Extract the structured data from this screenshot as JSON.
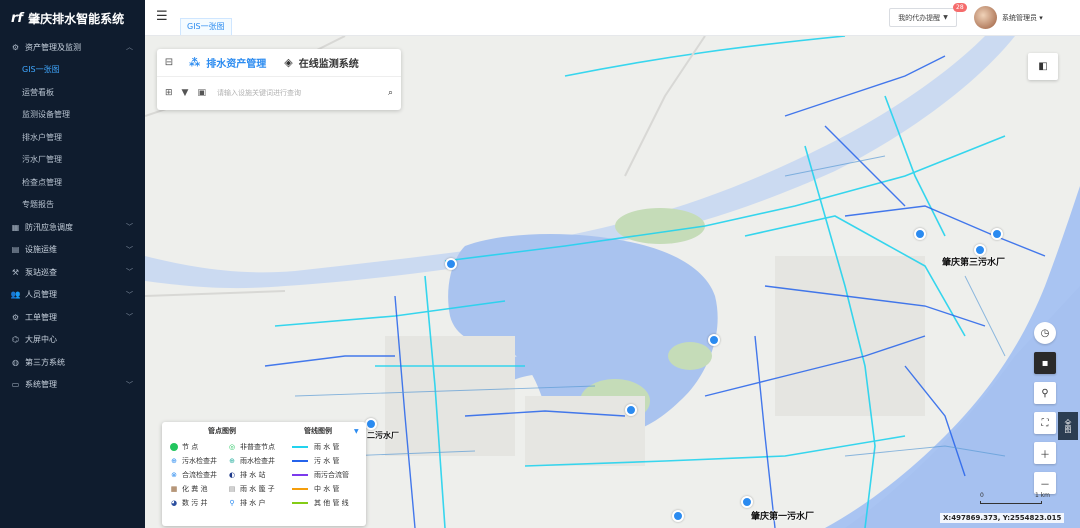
{
  "brand": {
    "logo": "rf",
    "title": "肇庆排水智能系统"
  },
  "sidebar": {
    "items": [
      {
        "label": "资产管理及监测",
        "icon": "gear-icon",
        "expanded": true
      },
      {
        "label": "GIS一张图",
        "active": true
      },
      {
        "label": "运营看板"
      },
      {
        "label": "监测设备管理"
      },
      {
        "label": "排水户管理"
      },
      {
        "label": "污水厂管理"
      },
      {
        "label": "检查点管理"
      },
      {
        "label": "专题报告"
      },
      {
        "label": "防汛应急调度",
        "icon": "grid-icon"
      },
      {
        "label": "设施运维",
        "icon": "server-icon"
      },
      {
        "label": "泵站巡查",
        "icon": "pump-icon"
      },
      {
        "label": "人员管理",
        "icon": "users-icon"
      },
      {
        "label": "工单管理",
        "icon": "settings-icon"
      },
      {
        "label": "大屏中心",
        "icon": "screen-icon"
      },
      {
        "label": "第三方系统",
        "icon": "globe-icon"
      },
      {
        "label": "系统管理",
        "icon": "monitor-icon"
      }
    ]
  },
  "header": {
    "tab": "GIS一张图",
    "todo_label": "我的代办提醒",
    "todo_count": "28",
    "user": "系统管理员"
  },
  "panel": {
    "tab_asset": "排水资产管理",
    "tab_monitor": "在线监测系统",
    "search_placeholder": "请输入设施关键词进行查询"
  },
  "map": {
    "labels": {
      "plant_3": "肇庆第三污水厂",
      "plant_1": "肇庆第一污水厂",
      "plant_2": "二污水厂"
    },
    "coords": "X:497869.373, Y:2554823.015",
    "scale": {
      "start": "0",
      "end": "1 km"
    },
    "fullscreen": "全图"
  },
  "legend": {
    "point_title": "管点图例",
    "line_title": "管线图例",
    "col1": [
      {
        "label": "节        点",
        "icon": "node-icon",
        "color": "#22c55e"
      },
      {
        "label": "污水检查井",
        "icon": "sewage-well-icon",
        "color": "#2b8bf0"
      },
      {
        "label": "合流检查井",
        "icon": "combined-well-icon",
        "color": "#2b8bf0"
      },
      {
        "label": "化  粪  池",
        "icon": "septic-tank-icon",
        "color": "#8b5a2b"
      },
      {
        "label": "数  污  井",
        "icon": "sewer-well-icon",
        "color": "#2b4f9f"
      }
    ],
    "col2": [
      {
        "label": "非普查节点",
        "icon": "nonsurvey-node-icon",
        "color": "#22c55e"
      },
      {
        "label": "雨水检查井",
        "icon": "rain-well-icon",
        "color": "#2bb0a0"
      },
      {
        "label": "排  水  站",
        "icon": "drain-station-icon",
        "color": "#1e3a8a"
      },
      {
        "label": "雨 水 篦 子",
        "icon": "rain-grate-icon",
        "color": "#888888"
      },
      {
        "label": "排  水  户",
        "icon": "drain-user-icon",
        "color": "#2b8bf0"
      }
    ],
    "col3": [
      {
        "label": "雨     水     管",
        "color": "#22d3ee"
      },
      {
        "label": "污     水     管",
        "color": "#2563eb"
      },
      {
        "label": "雨污合流管",
        "color": "#7c3aed"
      },
      {
        "label": "中     水     管",
        "color": "#f59e0b"
      },
      {
        "label": "其 他 管 线",
        "color": "#84cc16"
      }
    ]
  }
}
